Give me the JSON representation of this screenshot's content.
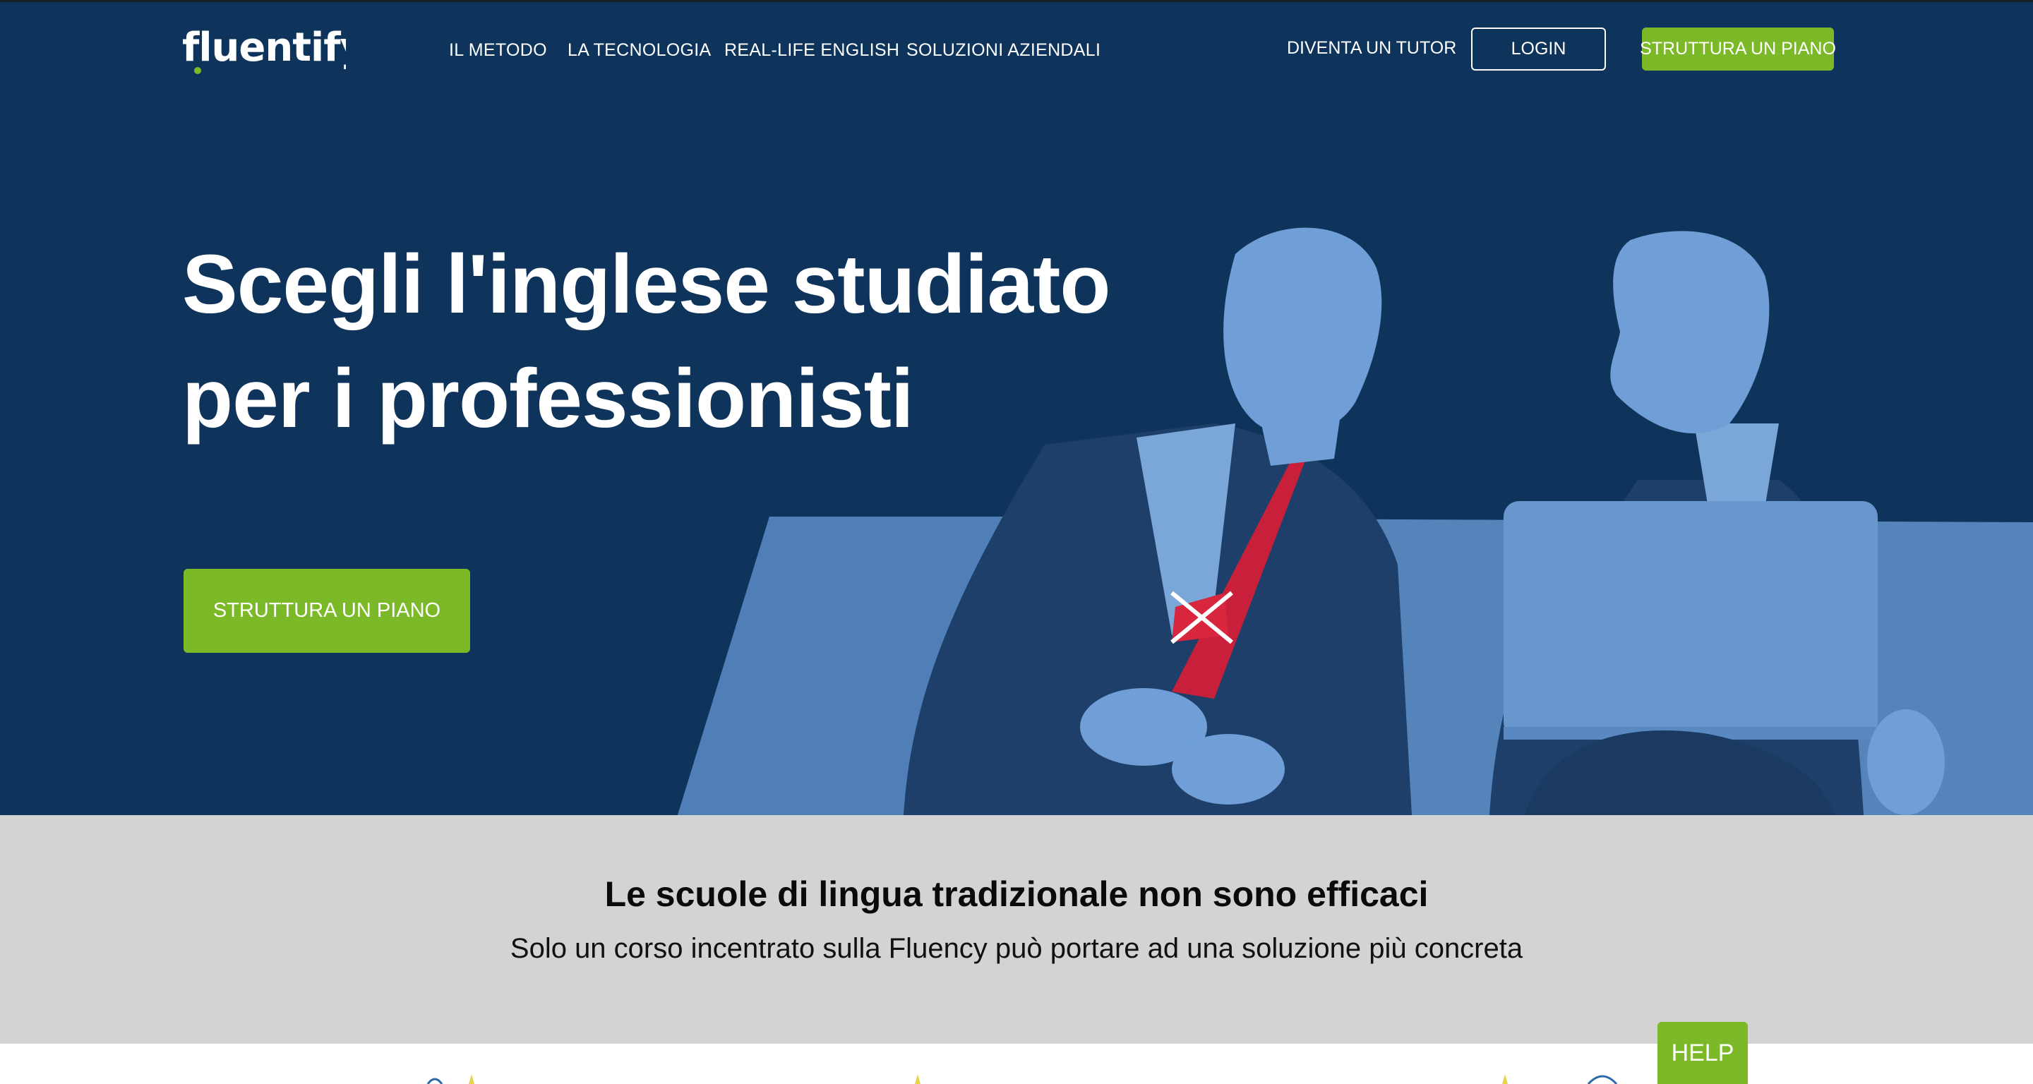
{
  "header": {
    "logo_text": "fluentify",
    "nav": [
      {
        "label": "IL METODO"
      },
      {
        "label": "LA TECNOLOGIA"
      },
      {
        "label": "REAL-LIFE ENGLISH"
      },
      {
        "label": "SOLUZIONI AZIENDALI"
      }
    ],
    "tutor_label": "DIVENTA UN TUTOR",
    "login_label": "LOGIN",
    "cta_label": "STRUTTURA UN PIANO"
  },
  "hero": {
    "headline_line1": "Scegli l'inglese studiato",
    "headline_line2": "per i professionisti",
    "cta_label": "STRUTTURA UN PIANO"
  },
  "band": {
    "title": "Le scuole di lingua tradizionale non sono efficaci",
    "subtitle": "Solo un corso incentrato sulla Fluency può portare ad una soluzione più concreta"
  },
  "help": {
    "label": "HELP"
  },
  "colors": {
    "hero_bg": "#0f345b",
    "accent_green": "#7cb928",
    "band_bg": "#d3d3d3",
    "figure_blue": "#5a8cc4"
  }
}
